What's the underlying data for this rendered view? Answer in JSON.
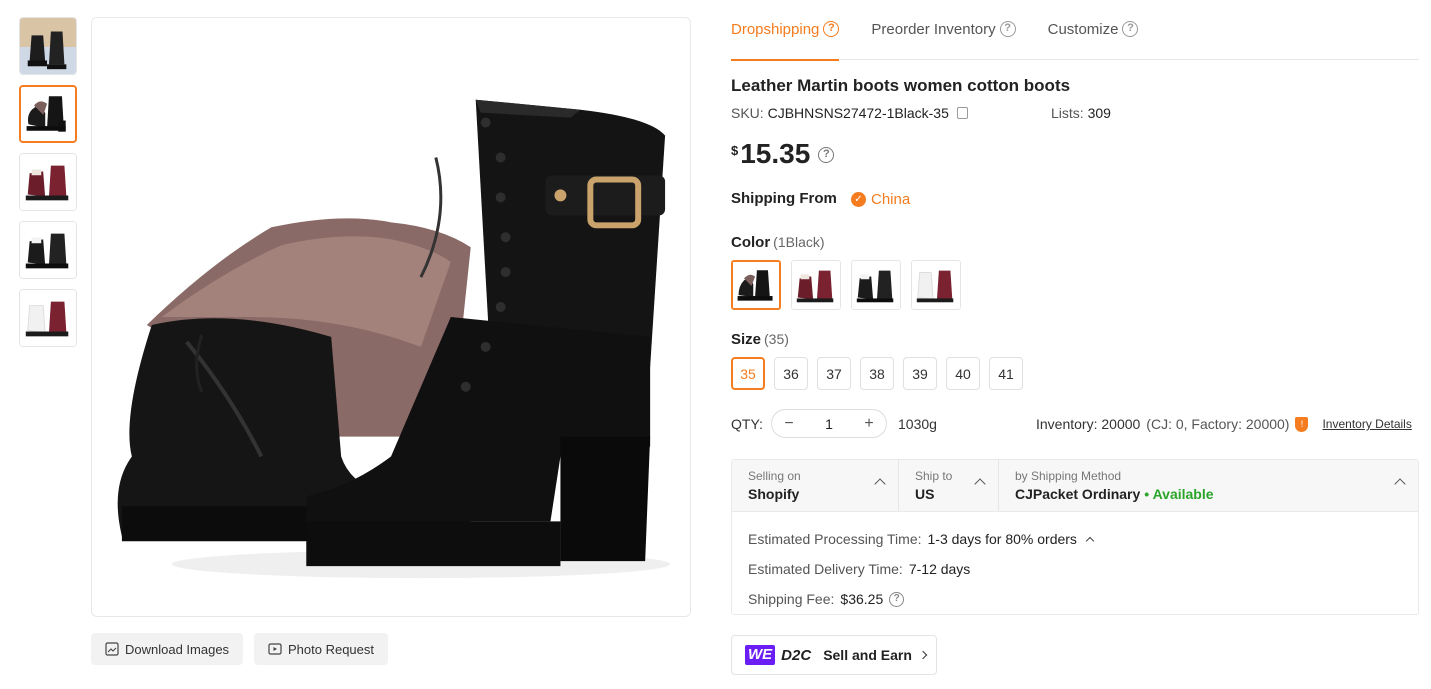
{
  "tabs": [
    {
      "label": "Dropshipping",
      "active": true
    },
    {
      "label": "Preorder Inventory",
      "active": false
    },
    {
      "label": "Customize",
      "active": false
    }
  ],
  "product": {
    "title": "Leather Martin boots women cotton boots",
    "sku_label": "SKU:",
    "sku_value": "CJBHNSNS27472-1Black-35",
    "lists_label": "Lists:",
    "lists_value": "309",
    "price_currency": "$",
    "price_value": "15.35"
  },
  "shipping_from": {
    "label": "Shipping From",
    "country": "China"
  },
  "color": {
    "label": "Color",
    "selected": "(1Black)",
    "swatches": [
      "1Black",
      "Red",
      "Black",
      "White Red"
    ]
  },
  "size": {
    "label": "Size",
    "selected": "(35)",
    "options": [
      "35",
      "36",
      "37",
      "38",
      "39",
      "40",
      "41"
    ]
  },
  "qty": {
    "label": "QTY:",
    "value": "1",
    "minus": "−",
    "plus": "+",
    "weight": "1030g"
  },
  "inventory": {
    "text": "Inventory: 20000",
    "sub": "(CJ: 0, Factory: 20000)",
    "link": "Inventory Details"
  },
  "shipping": {
    "selling_on_label": "Selling on",
    "selling_on_value": "Shopify",
    "ship_to_label": "Ship to",
    "ship_to_value": "US",
    "method_label": "by Shipping Method",
    "method_value": "CJPacket Ordinary",
    "availability": "• Available",
    "processing_label": "Estimated Processing Time:",
    "processing_value": "1-3 days for 80% orders",
    "delivery_label": "Estimated Delivery Time:",
    "delivery_value": "7-12 days",
    "fee_label": "Shipping Fee:",
    "fee_value": "$36.25"
  },
  "image_buttons": {
    "download": "Download Images",
    "photo_request": "Photo Request"
  },
  "d2c": {
    "we": "WE",
    "d2c": "D2C",
    "sell": "Sell and Earn"
  },
  "colors": {
    "accent": "#f57c1f",
    "available": "#2aa52a",
    "brand_purple": "#6a1df5"
  }
}
